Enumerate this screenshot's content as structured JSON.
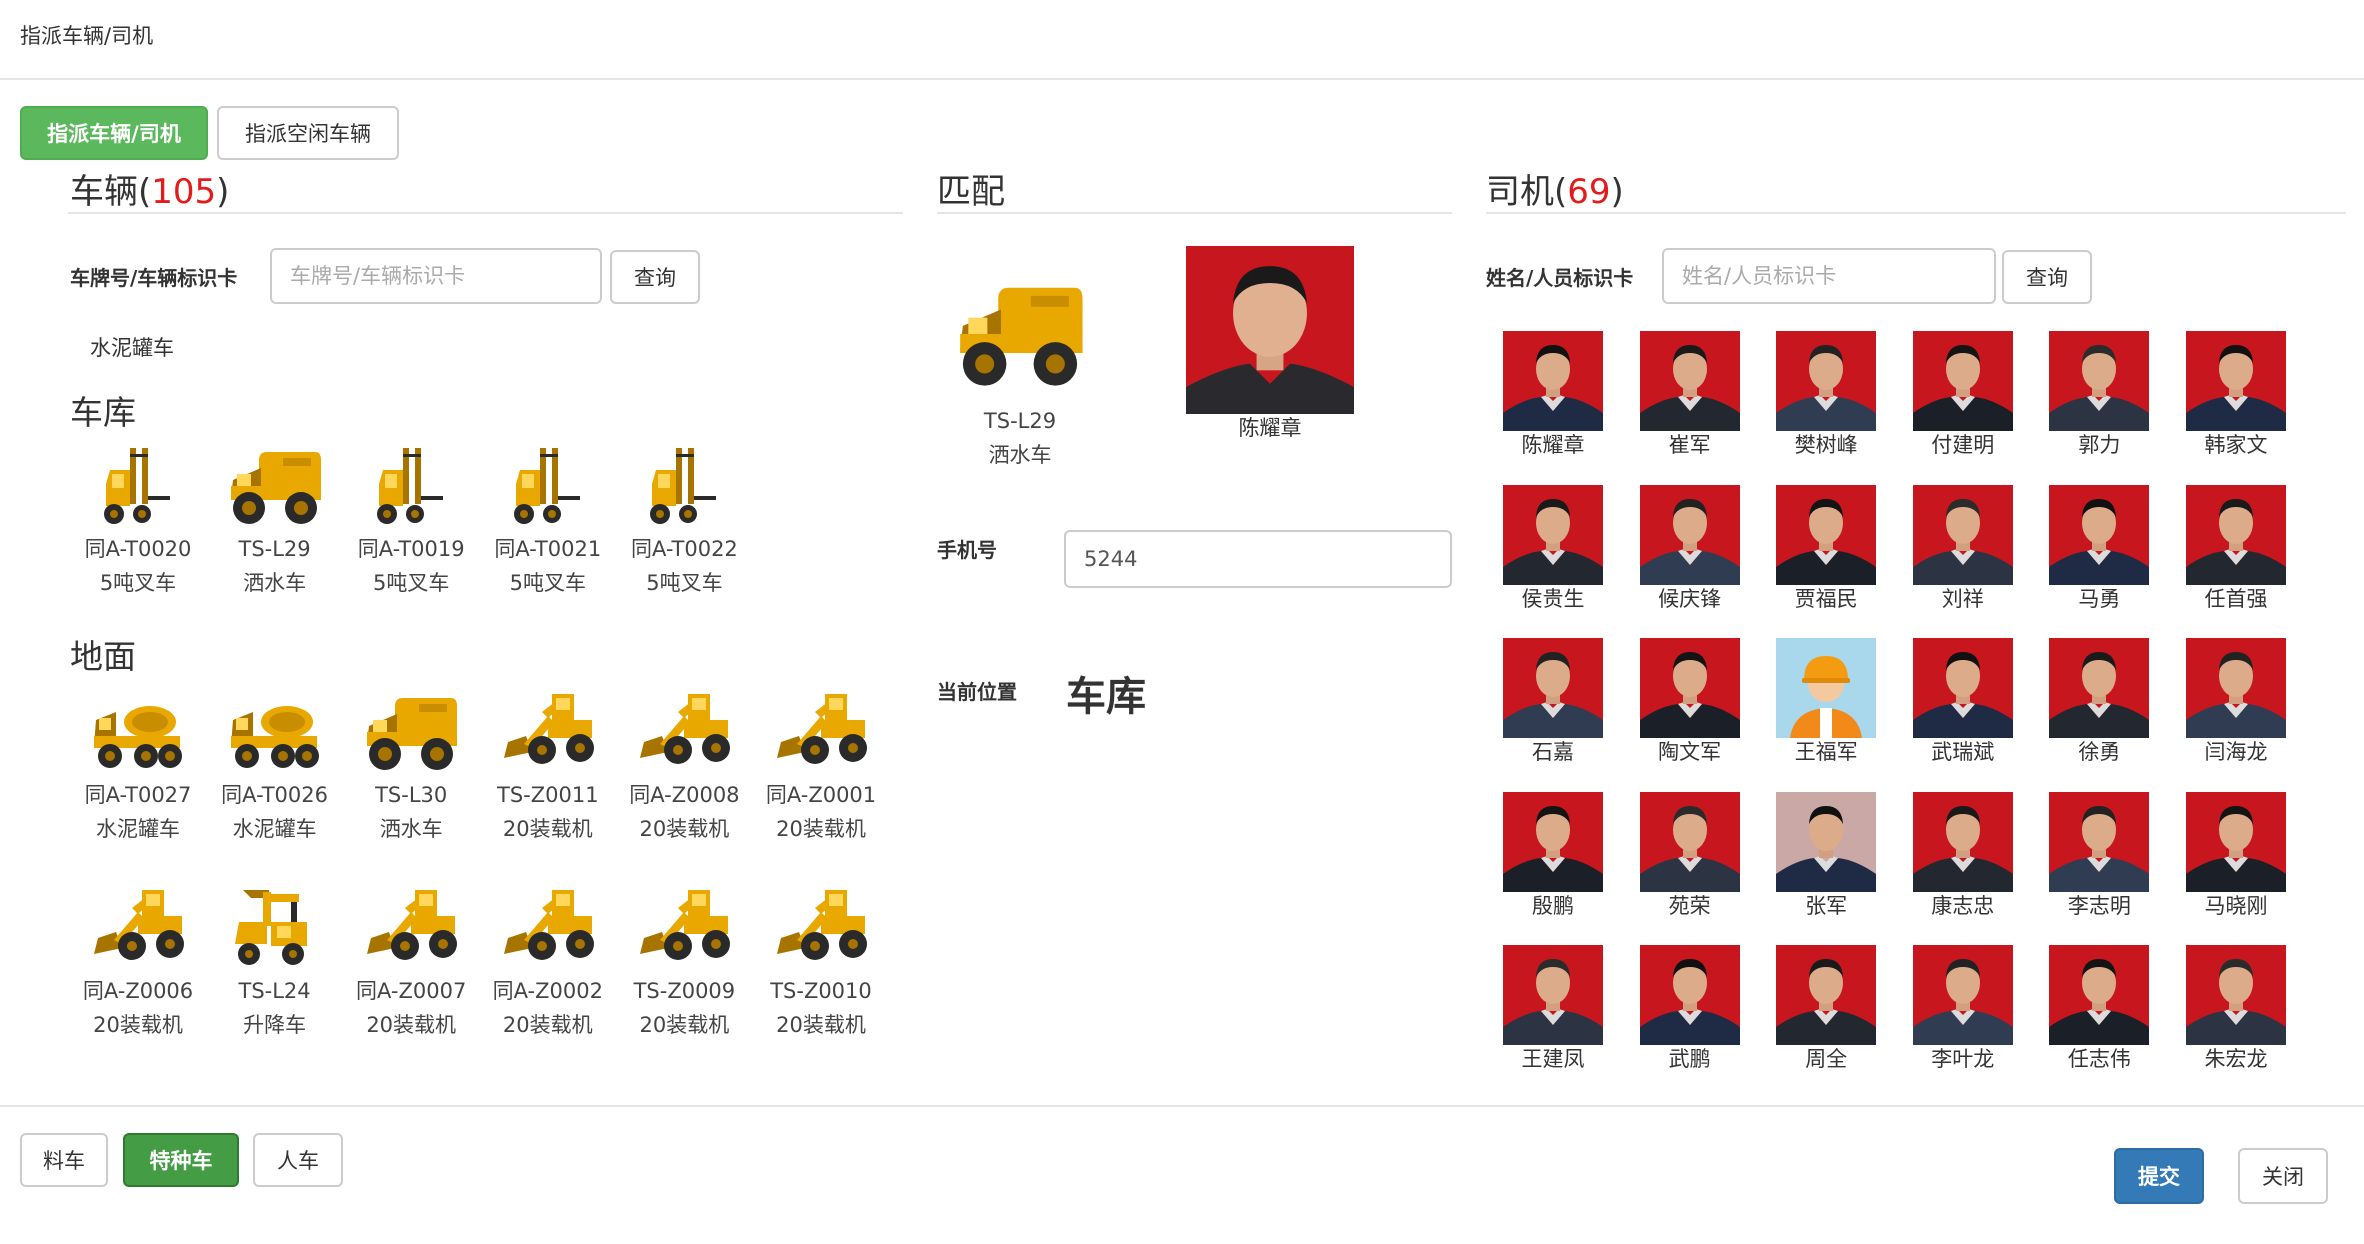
{
  "modal": {
    "title": "指派车辆/司机"
  },
  "tabs": {
    "assign": "指派车辆/司机",
    "idle": "指派空闲车辆"
  },
  "vehicles": {
    "title": "车辆",
    "count": "105",
    "search_label": "车牌号/车辆标识卡",
    "search_placeholder": "车牌号/车辆标识卡",
    "search_button": "查询",
    "type_label": "水泥罐车",
    "groups": [
      {
        "title": "车库",
        "items": [
          {
            "id": "同A-T0020",
            "type": "5吨叉车",
            "icon": "forklift-icon"
          },
          {
            "id": "TS-L29",
            "type": "洒水车",
            "icon": "water-truck-icon"
          },
          {
            "id": "同A-T0019",
            "type": "5吨叉车",
            "icon": "forklift-icon"
          },
          {
            "id": "同A-T0021",
            "type": "5吨叉车",
            "icon": "forklift-icon"
          },
          {
            "id": "同A-T0022",
            "type": "5吨叉车",
            "icon": "forklift-icon"
          }
        ]
      },
      {
        "title": "地面",
        "items": [
          {
            "id": "同A-T0027",
            "type": "水泥罐车",
            "icon": "mixer-truck-icon"
          },
          {
            "id": "同A-T0026",
            "type": "水泥罐车",
            "icon": "mixer-truck-icon"
          },
          {
            "id": "TS-L30",
            "type": "洒水车",
            "icon": "water-truck-icon"
          },
          {
            "id": "TS-Z0011",
            "type": "20装载机",
            "icon": "loader-icon"
          },
          {
            "id": "同A-Z0008",
            "type": "20装载机",
            "icon": "loader-icon"
          },
          {
            "id": "同A-Z0001",
            "type": "20装载机",
            "icon": "loader-icon"
          },
          {
            "id": "同A-Z0006",
            "type": "20装载机",
            "icon": "loader-icon"
          },
          {
            "id": "TS-L24",
            "type": "升降车",
            "icon": "lift-truck-icon"
          },
          {
            "id": "同A-Z0007",
            "type": "20装载机",
            "icon": "loader-icon"
          },
          {
            "id": "同A-Z0002",
            "type": "20装载机",
            "icon": "loader-icon"
          },
          {
            "id": "TS-Z0009",
            "type": "20装载机",
            "icon": "loader-icon"
          },
          {
            "id": "TS-Z0010",
            "type": "20装载机",
            "icon": "loader-icon"
          }
        ]
      }
    ]
  },
  "match": {
    "title": "匹配",
    "vehicle": {
      "id": "TS-L29",
      "type": "洒水车",
      "icon": "water-truck-icon"
    },
    "driver": {
      "name": "陈耀章"
    },
    "phone_label": "手机号",
    "phone_value": "5244",
    "location_label": "当前位置",
    "location_value": "车库"
  },
  "drivers": {
    "title": "司机",
    "count": "69",
    "search_label": "姓名/人员标识卡",
    "search_placeholder": "姓名/人员标识卡",
    "search_button": "查询",
    "list": [
      {
        "name": "陈耀章"
      },
      {
        "name": "崔军"
      },
      {
        "name": "樊树峰"
      },
      {
        "name": "付建明"
      },
      {
        "name": "郭力"
      },
      {
        "name": "韩家文"
      },
      {
        "name": "侯贵生"
      },
      {
        "name": "候庆锋"
      },
      {
        "name": "贾福民"
      },
      {
        "name": "刘祥"
      },
      {
        "name": "马勇"
      },
      {
        "name": "任首强"
      },
      {
        "name": "石嘉"
      },
      {
        "name": "陶文军"
      },
      {
        "name": "王福军",
        "avatar": "default"
      },
      {
        "name": "武瑞斌"
      },
      {
        "name": "徐勇"
      },
      {
        "name": "闫海龙"
      },
      {
        "name": "殷鹏"
      },
      {
        "name": "苑荣"
      },
      {
        "name": "张军",
        "bg": "light"
      },
      {
        "name": "康志忠"
      },
      {
        "name": "李志明"
      },
      {
        "name": "马晓刚"
      },
      {
        "name": "王建凤"
      },
      {
        "name": "武鹏"
      },
      {
        "name": "周全"
      },
      {
        "name": "李叶龙"
      },
      {
        "name": "任志伟"
      },
      {
        "name": "朱宏龙"
      }
    ]
  },
  "footer": {
    "cat_material": "料车",
    "cat_special": "特种车",
    "cat_people": "人车",
    "submit": "提交",
    "close": "关闭"
  },
  "colors": {
    "accent_green": "#5cb85c",
    "primary_blue": "#337ab7",
    "count_red": "#e31b1b",
    "vehicle_yellow": "#e8a800",
    "photo_red": "#c8161e"
  }
}
